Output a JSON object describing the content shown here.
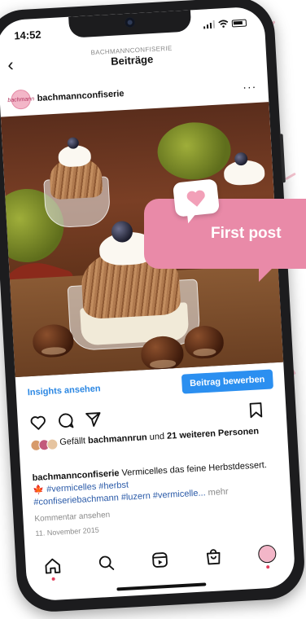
{
  "status_bar": {
    "time": "14:52"
  },
  "header": {
    "account": "BACHMANNCONFISERIE",
    "title": "Beiträge",
    "back_icon": "chevron-left-icon"
  },
  "post": {
    "username": "bachmannconfiserie",
    "avatar_text": "bachmann",
    "more_icon": "more-horizontal-icon",
    "insights_label": "Insights ansehen",
    "promote_label": "Beitrag bewerben",
    "likes": {
      "prefix": "Gefällt ",
      "user": "bachmannrun",
      "middle": " und ",
      "count_text": "21 weiteren Personen"
    },
    "caption": {
      "username": "bachmannconfiserie",
      "text": " Vermicelles das feine Herbstdessert.",
      "leaf_emoji": "🍁",
      "hashtags_1": " #vermicelles #herbst",
      "hashtags_2": "#confiseriebachmann #luzern #vermicelle...",
      "more": " mehr"
    },
    "comments_link": "Kommentar ansehen",
    "date": "11. November 2015"
  },
  "overlay": {
    "badge_label": "First post",
    "heart_icon": "heart-bubble-icon"
  },
  "tab_bar": {
    "items": [
      "home-icon",
      "search-icon",
      "reels-icon",
      "shop-icon",
      "profile-avatar"
    ]
  },
  "colors": {
    "accent_pink": "#e98aa8",
    "link_blue": "#2b87e3",
    "button_blue": "#2b8ff0",
    "notification_dot": "#e23d5c"
  }
}
